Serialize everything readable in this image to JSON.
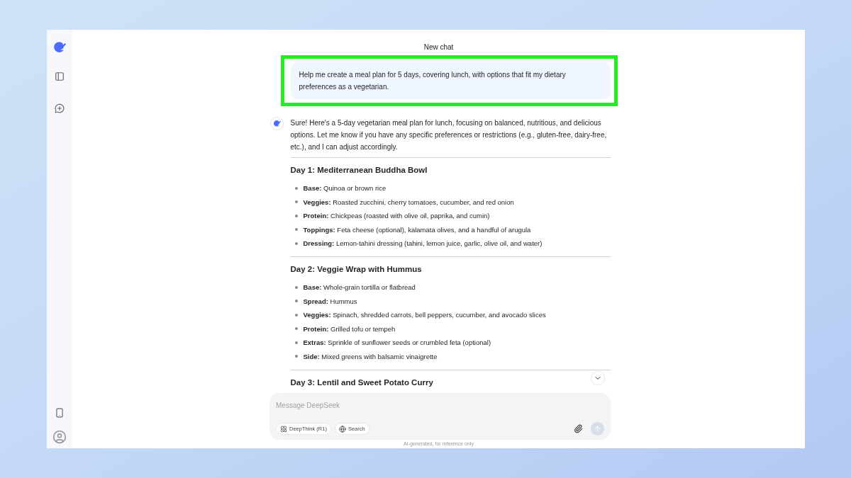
{
  "header": {
    "title": "New chat"
  },
  "user_message": {
    "text": "Help me create a meal plan for 5 days, covering lunch, with options that fit my dietary preferences as a vegetarian.",
    "highlighted": true
  },
  "assistant": {
    "intro": "Sure! Here's a 5-day vegetarian meal plan for lunch, focusing on balanced, nutritious, and delicious options. Let me know if you have any specific preferences or restrictions (e.g., gluten-free, dairy-free, etc.), and I can adjust accordingly.",
    "sections": [
      {
        "title": "Day 1: Mediterranean Buddha Bowl",
        "items": [
          "**Base:** Quinoa or brown rice",
          "**Veggies:** Roasted zucchini, cherry tomatoes, cucumber, and red onion",
          "**Protein:** Chickpeas (roasted with olive oil, paprika, and cumin)",
          "**Toppings:** Feta cheese (optional), kalamata olives, and a handful of arugula",
          "**Dressing:** Lemon-tahini dressing (tahini, lemon juice, garlic, olive oil, and water)"
        ]
      },
      {
        "title": "Day 2: Veggie Wrap with Hummus",
        "items": [
          "**Base:** Whole-grain tortilla or flatbread",
          "**Spread:** Hummus",
          "**Veggies:** Spinach, shredded carrots, bell peppers, cucumber, and avocado slices",
          "**Protein:** Grilled tofu or tempeh",
          "**Extras:** Sprinkle of sunflower seeds or crumbled feta (optional)",
          "**Side:** Mixed greens with balsamic vinaigrette"
        ]
      },
      {
        "title": "Day 3: Lentil and Sweet Potato Curry"
      }
    ]
  },
  "composer": {
    "placeholder": "Message DeepSeek",
    "toggles": [
      {
        "kind": "deepthink",
        "label": "DeepThink (R1)",
        "selected": false
      },
      {
        "kind": "search",
        "label": "Search",
        "selected": false
      }
    ],
    "send_disabled": true
  },
  "footer_note": "AI-generated, for reference only"
}
